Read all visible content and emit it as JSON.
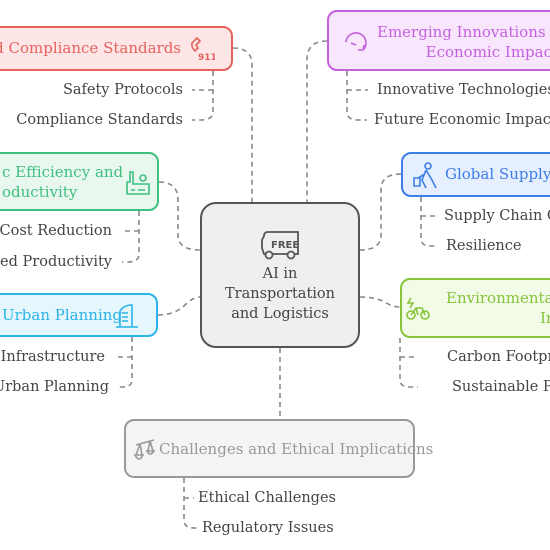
{
  "center": {
    "title_lines": [
      "AI in",
      "Transportation",
      "and Logistics"
    ],
    "icon": "free-delivery-truck-icon",
    "icon_text": "FREE"
  },
  "branches": [
    {
      "id": "safety",
      "title_lines": [
        "nd Compliance Standards"
      ],
      "icon": "phone-911-icon",
      "icon_text": "911",
      "color": "#e5635f",
      "bg": "#fde6e5",
      "children": [
        "Safety Protocols",
        "Compliance Standards"
      ]
    },
    {
      "id": "efficiency",
      "title_lines": [
        "c Efficiency and",
        "oductivity"
      ],
      "icon": "factory-icon",
      "color": "#3ebf7f",
      "bg": "#e8f8ef",
      "children": [
        "Cost Reduction",
        "sed Productivity"
      ]
    },
    {
      "id": "urban",
      "title_lines": [
        "Urban Planning"
      ],
      "icon": "building-icon",
      "color": "#2bb4e6",
      "bg": "#e6f6fd",
      "children": [
        "rt Infrastructure",
        "Urban Planning"
      ]
    },
    {
      "id": "innovation",
      "title_lines": [
        "Emerging Innovations an",
        "Economic Impac"
      ],
      "icon": "circular-arrow-icon",
      "color": "#c561e0",
      "bg": "#f7e6fc",
      "children": [
        "Innovative Technologies",
        "Future Economic Impact"
      ]
    },
    {
      "id": "supply",
      "title_lines": [
        "Global Supply C"
      ],
      "icon": "person-pushing-cart-icon",
      "color": "#3d7ee6",
      "bg": "#e5efff",
      "children": [
        "Supply Chain O",
        "Resilience"
      ]
    },
    {
      "id": "environment",
      "title_lines": [
        "Environmental",
        "In"
      ],
      "icon": "electric-bike-icon",
      "color": "#86c43a",
      "bg": "#f2fae8",
      "children": [
        "Carbon Footpr",
        "Sustainable Pr"
      ]
    },
    {
      "id": "challenges",
      "title_lines": [
        "Challenges and Ethical Implications"
      ],
      "icon": "balance-scale-icon",
      "color": "#999999",
      "bg": "#f4f4f4",
      "children": [
        "Ethical Challenges",
        "Regulatory Issues"
      ]
    }
  ]
}
